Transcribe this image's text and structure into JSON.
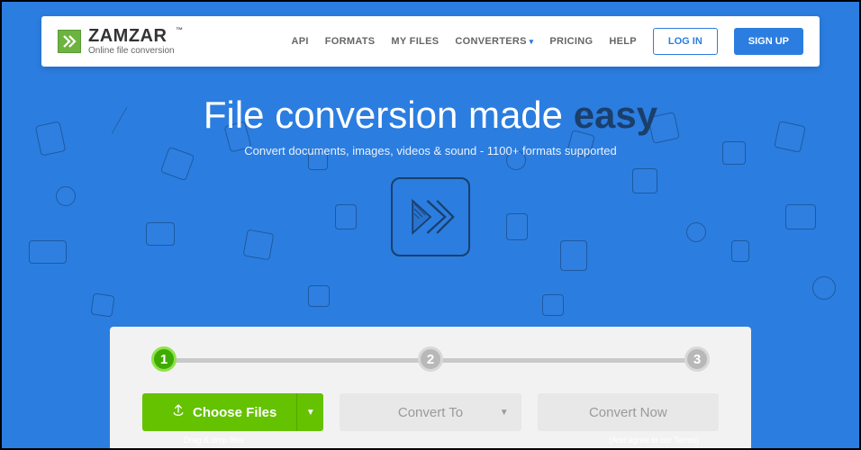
{
  "brand": {
    "name": "ZAMZAR",
    "tagline": "Online file conversion"
  },
  "nav": {
    "api": "API",
    "formats": "FORMATS",
    "myfiles": "MY FILES",
    "converters": "CONVERTERS",
    "pricing": "PRICING",
    "help": "HELP",
    "login": "LOG IN",
    "signup": "SIGN UP"
  },
  "hero": {
    "title_pre": "File conversion made ",
    "title_emph": "easy",
    "subtitle": "Convert documents, images, videos & sound - 1100+ formats supported"
  },
  "steps": {
    "s1": "1",
    "s2": "2",
    "s3": "3"
  },
  "actions": {
    "choose": "Choose Files",
    "convert_to": "Convert To",
    "convert_now": "Convert Now",
    "hint_drag": "Drag & drop files",
    "hint_terms": "(And agree to our Terms)"
  }
}
